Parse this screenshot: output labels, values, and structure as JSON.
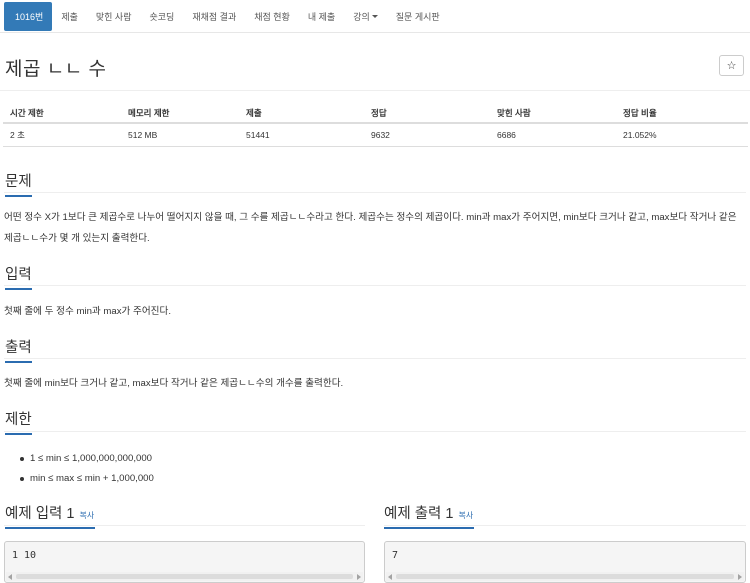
{
  "nav": {
    "items": [
      {
        "label": "1016번",
        "active": true
      },
      {
        "label": "제출"
      },
      {
        "label": "맞힌 사람"
      },
      {
        "label": "숏코딩"
      },
      {
        "label": "재채점 결과"
      },
      {
        "label": "채점 현황"
      },
      {
        "label": "내 제출"
      },
      {
        "label": "강의",
        "dropdown": true
      },
      {
        "label": "질문 게시판"
      }
    ]
  },
  "problem": {
    "title": "제곱 ㄴㄴ 수",
    "star": "☆"
  },
  "stats": {
    "headers": [
      "시간 제한",
      "메모리 제한",
      "제출",
      "정답",
      "맞힌 사람",
      "정답 비율"
    ],
    "values": [
      "2 초",
      "512 MB",
      "51441",
      "9632",
      "6686",
      "21.052%"
    ]
  },
  "sections": {
    "description": {
      "heading": "문제",
      "text": "어떤 정수 X가 1보다 큰 제곱수로 나누어 떨어지지 않을 때, 그 수를 제곱ㄴㄴ수라고 한다. 제곱수는 정수의 제곱이다. min과 max가 주어지면, min보다 크거나 같고, max보다 작거나 같은 제곱ㄴㄴ수가 몇 개 있는지 출력한다."
    },
    "input": {
      "heading": "입력",
      "text": "첫째 줄에 두 정수 min과 max가 주어진다."
    },
    "output": {
      "heading": "출력",
      "text": "첫째 줄에 min보다 크거나 같고, max보다 작거나 같은 제곱ㄴㄴ수의 개수를 출력한다."
    },
    "limits": {
      "heading": "제한",
      "items": [
        "1 ≤ min ≤ 1,000,000,000,000",
        "min ≤ max ≤ min + 1,000,000"
      ]
    }
  },
  "samples": {
    "input": {
      "heading": "예제 입력 1",
      "copy": "복사",
      "content": "1 10"
    },
    "output": {
      "heading": "예제 출력 1",
      "copy": "복사",
      "content": "7"
    }
  }
}
